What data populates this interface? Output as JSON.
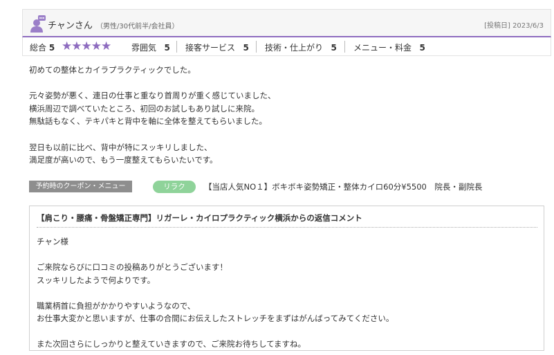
{
  "reviewer": {
    "name": "チャンさん",
    "meta": "（男性/30代前半/会社員）",
    "post_date": "[投稿日] 2023/6/3",
    "avatar_icon": "user-icon"
  },
  "ratings": {
    "overall_label": "総合",
    "overall_score": "5",
    "stars": "★★★★★",
    "star_count": 5,
    "star_color": "#8d6bbf",
    "items": [
      {
        "label": "雰囲気",
        "score": "5"
      },
      {
        "label": "接客サービス",
        "score": "5"
      },
      {
        "label": "技術・仕上がり",
        "score": "5"
      },
      {
        "label": "メニュー・料金",
        "score": "5"
      }
    ]
  },
  "review": {
    "lines": [
      "初めての整体とカイラプラクティックでした。",
      "",
      "元々姿勢が悪く、連日の仕事と重なり首周りが重く感じていました、",
      "横浜周辺で調べていたところ、初回のお試しもあり試しに来院。",
      "無駄話もなく、テキパキと背中を軸に全体を整えてもらいました。",
      "",
      "翌日も以前に比べ、背中が特にスッキリしました、",
      "満足度が高いので、もう一度整えてもらいたいです。"
    ]
  },
  "coupon": {
    "label": "予約時のクーポン・メニュー",
    "tag": "リラク",
    "name": "【当店人気NO１】ボキボキ姿勢矯正・整体カイロ60分¥5500　院長・副院長"
  },
  "reply": {
    "title": "【肩こり・腰痛・骨盤矯正専門】リガーレ・カイロプラクティック横浜からの返信コメント",
    "lines": [
      "チャン様",
      "",
      "ご来院ならびに口コミの投稿ありがとうございます！",
      "スッキリしたようで何よりです。",
      "",
      "職業柄首に負担がかかりやすいようなので、",
      "お仕事大変かと思いますが、仕事の合間にお伝えしたストレッチをまずはがんばってみてください。",
      "",
      "また次回さらにしっかりと整えていきますので、ご来院お待ちしてますね。"
    ]
  }
}
